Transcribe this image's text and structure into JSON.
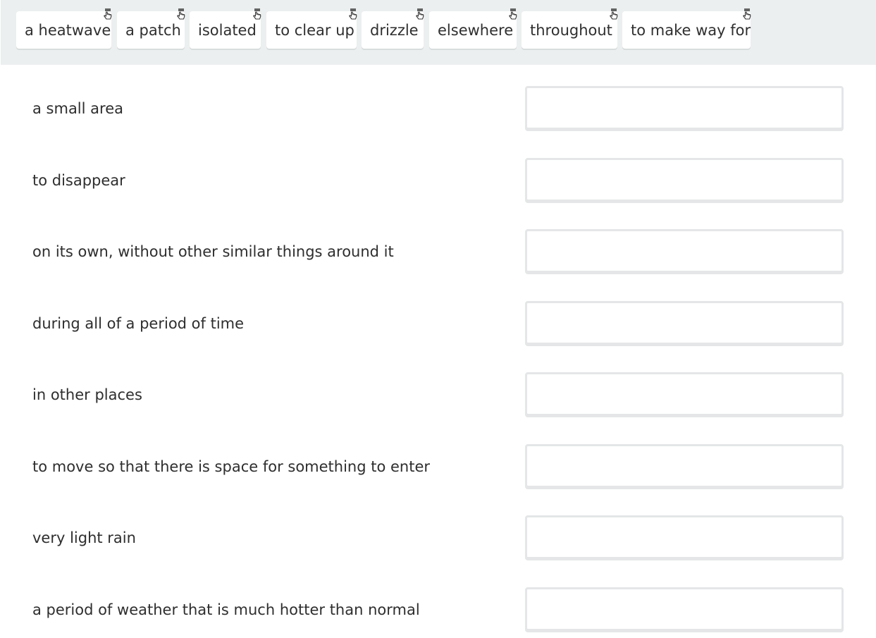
{
  "word_bank": {
    "chips": [
      {
        "label": "a heatwave",
        "icon": "drag-handle-icon"
      },
      {
        "label": "a patch",
        "icon": "drag-handle-icon"
      },
      {
        "label": "isolated",
        "icon": "drag-handle-icon"
      },
      {
        "label": "to clear up",
        "icon": "drag-handle-icon"
      },
      {
        "label": "drizzle",
        "icon": "drag-handle-icon"
      },
      {
        "label": "elsewhere",
        "icon": "drag-handle-icon"
      },
      {
        "label": "throughout",
        "icon": "drag-handle-icon"
      },
      {
        "label": "to make way for",
        "icon": "drag-handle-icon"
      }
    ]
  },
  "matching": {
    "rows": [
      {
        "definition": "a small area",
        "answer": ""
      },
      {
        "definition": "to disappear",
        "answer": ""
      },
      {
        "definition": "on its own, without other similar things around it",
        "answer": ""
      },
      {
        "definition": "during all of a period of time",
        "answer": ""
      },
      {
        "definition": "in other places",
        "answer": ""
      },
      {
        "definition": "to move so that there is space for something to enter",
        "answer": ""
      },
      {
        "definition": "very light rain",
        "answer": ""
      },
      {
        "definition": "a period of weather that is much hotter than normal",
        "answer": ""
      }
    ]
  },
  "colors": {
    "word_bank_background": "#eceff0",
    "chip_background": "#ffffff",
    "drop_box_border": "#e4e6e7",
    "text": "#2e2e2e"
  }
}
